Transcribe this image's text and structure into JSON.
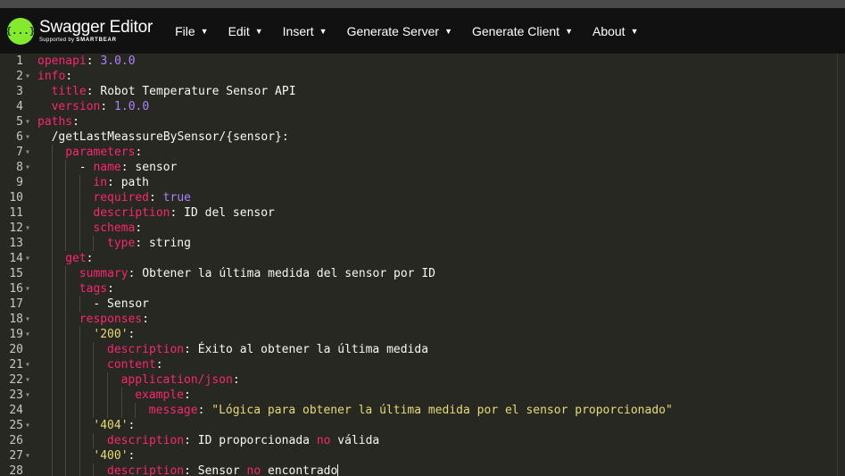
{
  "app": {
    "logo_title": "Swagger Editor",
    "logo_sub_prefix": "Supported by",
    "logo_sub_brand": "SMARTBEAR",
    "logo_glyph": "{...}"
  },
  "menu": [
    {
      "label": "File",
      "name": "menu-file"
    },
    {
      "label": "Edit",
      "name": "menu-edit"
    },
    {
      "label": "Insert",
      "name": "menu-insert"
    },
    {
      "label": "Generate Server",
      "name": "menu-generate-server"
    },
    {
      "label": "Generate Client",
      "name": "menu-generate-client"
    },
    {
      "label": "About",
      "name": "menu-about"
    }
  ],
  "colors": {
    "key": "#f92672",
    "number": "#ae81ff",
    "string": "#e6db74",
    "text": "#f8f8f2",
    "editor_bg": "#272822",
    "logo_green": "#85ea2d"
  },
  "editor": {
    "lines": [
      {
        "no": "1",
        "indent": 0,
        "fold": false,
        "tokens": [
          [
            "k",
            "openapi"
          ],
          [
            "t",
            ": "
          ],
          [
            "n",
            "3.0.0"
          ]
        ]
      },
      {
        "no": "2",
        "indent": 0,
        "fold": true,
        "tokens": [
          [
            "k",
            "info"
          ],
          [
            "t",
            ":"
          ]
        ]
      },
      {
        "no": "3",
        "indent": 1,
        "fold": false,
        "tokens": [
          [
            "k",
            "title"
          ],
          [
            "t",
            ": Robot Temperature Sensor API"
          ]
        ]
      },
      {
        "no": "4",
        "indent": 1,
        "fold": false,
        "tokens": [
          [
            "k",
            "version"
          ],
          [
            "t",
            ": "
          ],
          [
            "n",
            "1.0.0"
          ]
        ]
      },
      {
        "no": "5",
        "indent": 0,
        "fold": true,
        "tokens": [
          [
            "k",
            "paths"
          ],
          [
            "t",
            ":"
          ]
        ]
      },
      {
        "no": "6",
        "indent": 1,
        "fold": true,
        "tokens": [
          [
            "t",
            "/getLastMeassureBySensor/{sensor}:"
          ]
        ]
      },
      {
        "no": "7",
        "indent": 2,
        "fold": true,
        "tokens": [
          [
            "k",
            "parameters"
          ],
          [
            "t",
            ":"
          ]
        ]
      },
      {
        "no": "8",
        "indent": 3,
        "fold": true,
        "tokens": [
          [
            "t",
            "- "
          ],
          [
            "k",
            "name"
          ],
          [
            "t",
            ": sensor"
          ]
        ]
      },
      {
        "no": "9",
        "indent": 4,
        "fold": false,
        "tokens": [
          [
            "k",
            "in"
          ],
          [
            "t",
            ": path"
          ]
        ]
      },
      {
        "no": "10",
        "indent": 4,
        "fold": false,
        "tokens": [
          [
            "k",
            "required"
          ],
          [
            "t",
            ": "
          ],
          [
            "n",
            "true"
          ]
        ]
      },
      {
        "no": "11",
        "indent": 4,
        "fold": false,
        "tokens": [
          [
            "k",
            "description"
          ],
          [
            "t",
            ": ID del sensor"
          ]
        ]
      },
      {
        "no": "12",
        "indent": 4,
        "fold": true,
        "tokens": [
          [
            "k",
            "schema"
          ],
          [
            "t",
            ":"
          ]
        ]
      },
      {
        "no": "13",
        "indent": 5,
        "fold": false,
        "tokens": [
          [
            "k",
            "type"
          ],
          [
            "t",
            ": string"
          ]
        ]
      },
      {
        "no": "14",
        "indent": 2,
        "fold": true,
        "tokens": [
          [
            "k",
            "get"
          ],
          [
            "t",
            ":"
          ]
        ]
      },
      {
        "no": "15",
        "indent": 3,
        "fold": false,
        "tokens": [
          [
            "k",
            "summary"
          ],
          [
            "t",
            ": Obtener la última medida del sensor por ID"
          ]
        ]
      },
      {
        "no": "16",
        "indent": 3,
        "fold": true,
        "tokens": [
          [
            "k",
            "tags"
          ],
          [
            "t",
            ":"
          ]
        ]
      },
      {
        "no": "17",
        "indent": 4,
        "fold": false,
        "tokens": [
          [
            "t",
            "- Sensor"
          ]
        ]
      },
      {
        "no": "18",
        "indent": 3,
        "fold": true,
        "tokens": [
          [
            "k",
            "responses"
          ],
          [
            "t",
            ":"
          ]
        ]
      },
      {
        "no": "19",
        "indent": 4,
        "fold": true,
        "tokens": [
          [
            "s",
            "'200'"
          ],
          [
            "t",
            ":"
          ]
        ]
      },
      {
        "no": "20",
        "indent": 5,
        "fold": false,
        "tokens": [
          [
            "k",
            "description"
          ],
          [
            "t",
            ": Éxito al obtener la última medida"
          ]
        ]
      },
      {
        "no": "21",
        "indent": 5,
        "fold": true,
        "tokens": [
          [
            "k",
            "content"
          ],
          [
            "t",
            ":"
          ]
        ]
      },
      {
        "no": "22",
        "indent": 6,
        "fold": true,
        "tokens": [
          [
            "k",
            "application/json"
          ],
          [
            "t",
            ":"
          ]
        ]
      },
      {
        "no": "23",
        "indent": 7,
        "fold": true,
        "tokens": [
          [
            "k",
            "example"
          ],
          [
            "t",
            ":"
          ]
        ]
      },
      {
        "no": "24",
        "indent": 8,
        "fold": false,
        "tokens": [
          [
            "k",
            "message"
          ],
          [
            "t",
            ": "
          ],
          [
            "s",
            "\"Lógica para obtener la última medida por el sensor proporcionado\""
          ]
        ]
      },
      {
        "no": "25",
        "indent": 4,
        "fold": true,
        "tokens": [
          [
            "s",
            "'404'"
          ],
          [
            "t",
            ":"
          ]
        ]
      },
      {
        "no": "26",
        "indent": 5,
        "fold": false,
        "tokens": [
          [
            "k",
            "description"
          ],
          [
            "t",
            ": ID proporcionada "
          ],
          [
            "k",
            "no"
          ],
          [
            "t",
            " válida"
          ]
        ]
      },
      {
        "no": "27",
        "indent": 4,
        "fold": true,
        "tokens": [
          [
            "s",
            "'400'"
          ],
          [
            "t",
            ":"
          ]
        ]
      },
      {
        "no": "28",
        "indent": 5,
        "fold": false,
        "cursor": true,
        "tokens": [
          [
            "k",
            "description"
          ],
          [
            "t",
            ": Sensor "
          ],
          [
            "k",
            "no"
          ],
          [
            "t",
            " encontrado"
          ]
        ]
      }
    ]
  }
}
